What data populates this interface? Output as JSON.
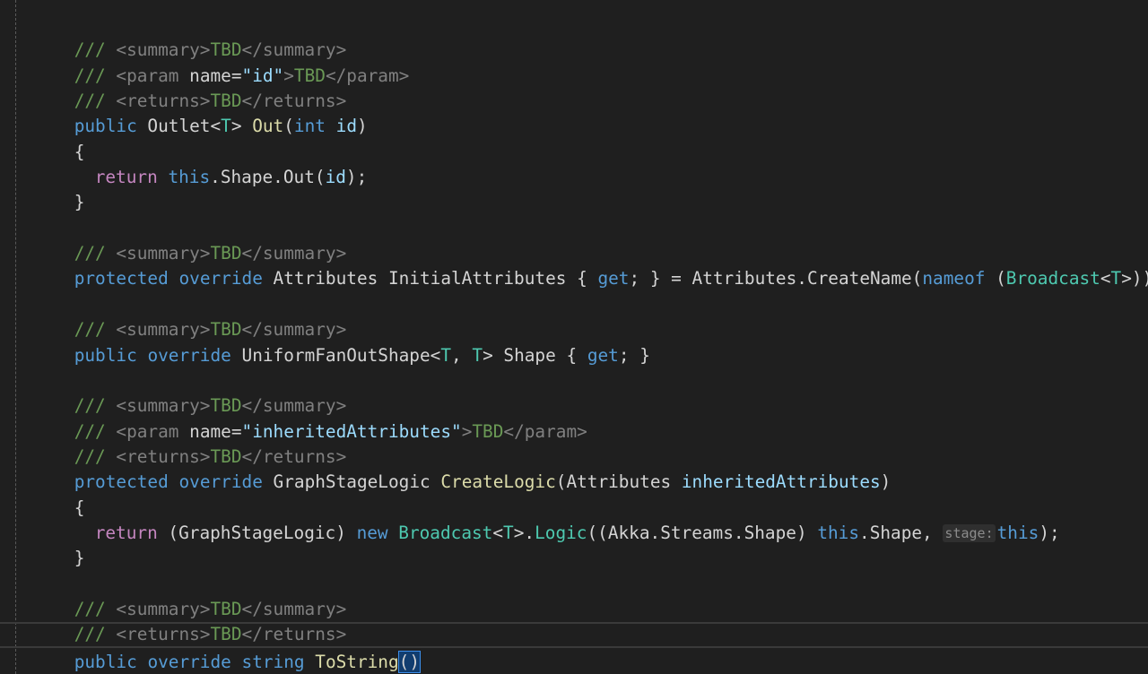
{
  "editor": {
    "hint_stage": "stage:",
    "lines": {
      "l1": [
        "/// ",
        "<summary>",
        "TBD",
        "</summary>"
      ],
      "l2": [
        "/// ",
        "<param ",
        "name=",
        "\"id\"",
        ">",
        "TBD",
        "</param>"
      ],
      "l3": [
        "/// ",
        "<returns>",
        "TBD",
        "</returns>"
      ],
      "l4": [
        "public",
        " Outlet<",
        "T",
        "> ",
        "Out",
        "(",
        "int",
        " ",
        "id",
        ")"
      ],
      "l5": [
        "{"
      ],
      "l6": [
        "return",
        " ",
        "this",
        ".Shape.Out(",
        "id",
        ");"
      ],
      "l7": [
        "}"
      ],
      "l9": [
        "/// ",
        "<summary>",
        "TBD",
        "</summary>"
      ],
      "l10": [
        "protected",
        " ",
        "override",
        " Attributes InitialAttributes { ",
        "get",
        "; } = Attributes.CreateName(",
        "nameof",
        " (",
        "Broadcast",
        "<",
        "T",
        ">));"
      ],
      "l12": [
        "/// ",
        "<summary>",
        "TBD",
        "</summary>"
      ],
      "l13": [
        "public",
        " ",
        "override",
        " UniformFanOutShape<",
        "T",
        ", ",
        "T",
        "> Shape { ",
        "get",
        "; }"
      ],
      "l15": [
        "/// ",
        "<summary>",
        "TBD",
        "</summary>"
      ],
      "l16": [
        "/// ",
        "<param ",
        "name=",
        "\"inheritedAttributes\"",
        ">",
        "TBD",
        "</param>"
      ],
      "l17": [
        "/// ",
        "<returns>",
        "TBD",
        "</returns>"
      ],
      "l18": [
        "protected",
        " ",
        "override",
        " GraphStageLogic ",
        "CreateLogic",
        "(Attributes ",
        "inheritedAttributes",
        ")"
      ],
      "l19": [
        "{"
      ],
      "l20": [
        "return",
        " (GraphStageLogic) ",
        "new",
        " ",
        "Broadcast",
        "<",
        "T",
        ">.",
        "Logic",
        "((Akka.Streams.Shape) ",
        "this",
        ".Shape, ",
        "this",
        ");"
      ],
      "l21": [
        "}"
      ],
      "l23": [
        "/// ",
        "<summary>",
        "TBD",
        "</summary>"
      ],
      "l24": [
        "/// ",
        "<returns>",
        "TBD",
        "</returns>"
      ],
      "l25": [
        "public",
        " ",
        "override",
        " ",
        "string",
        " ",
        "ToString",
        "()"
      ],
      "l26": [
        "{"
      ]
    }
  },
  "colors": {
    "background": "#1f1f1f",
    "comment": "#6a9955",
    "xml_tag": "#808080",
    "keyword": "#569cd6",
    "control_keyword": "#c586c0",
    "type": "#4ec9b0",
    "function": "#dcdcaa",
    "parameter": "#9cdcfe",
    "default_text": "#d4d4d4"
  }
}
